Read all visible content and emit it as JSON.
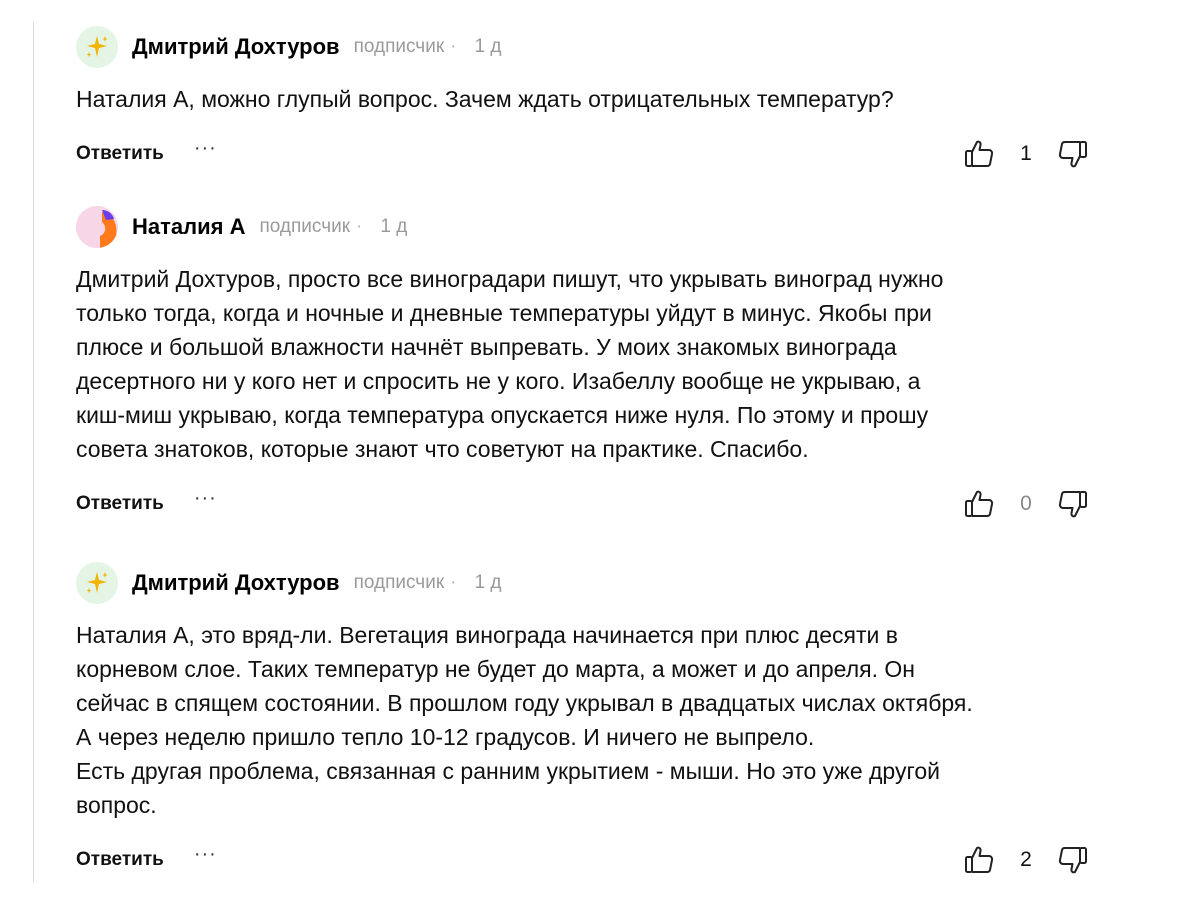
{
  "comments": [
    {
      "author": "Дмитрий Дохтуров",
      "role": "подписчик",
      "separator": "·",
      "time": "1 д",
      "avatar_icon": "sparkles-icon",
      "text": "Наталия А, можно глупый вопрос. Зачем ждать отрицательных температур?",
      "reply_label": "Ответить",
      "more_label": "···",
      "likes": "1"
    },
    {
      "author": "Наталия А",
      "role": "подписчик",
      "separator": "·",
      "time": "1 д",
      "avatar_icon": "user-avatar",
      "text": "Дмитрий Дохтуров, просто все виноградари пишут, что укрывать виноград нужно\nтолько тогда, когда и ночные и дневные температуры уйдут в минус. Якобы при\nплюсе и большой влажности начнёт выпревать. У моих знакомых винограда\nдесертного ни у кого нет и спросить не у кого. Изабеллу вообще не укрываю, а\nкиш-миш укрываю, когда температура опускается ниже нуля. По этому и прошу\nсовета знатоков, которые знают что советуют на практике. Спасибо.",
      "reply_label": "Ответить",
      "more_label": "···",
      "likes": "0"
    },
    {
      "author": "Дмитрий Дохтуров",
      "role": "подписчик",
      "separator": "·",
      "time": "1 д",
      "avatar_icon": "sparkles-icon",
      "text": "Наталия А, это вряд-ли. Вегетация винограда начинается при плюс десяти в\nкорневом слое. Таких температур не будет до марта, а может и до апреля. Он\nсейчас в спящем состоянии. В прошлом году укрывал в двадцатых числах октября.\nА через неделю пришло тепло 10-12 градусов. И ничего не выпрело.\nЕсть другая проблема, связанная с ранним укрытием - мыши. Но это уже другой\nвопрос.",
      "reply_label": "Ответить",
      "more_label": "···",
      "likes": "2"
    }
  ],
  "colors": {
    "sparkle": "#f2b400",
    "sparkle_bg": "#e4f5e6",
    "avatar_pink": "#f7d6e8",
    "avatar_orange": "#ff7a1a",
    "avatar_purple": "#6a3df0",
    "muted": "#9a9a9a",
    "icon": "#222222"
  }
}
